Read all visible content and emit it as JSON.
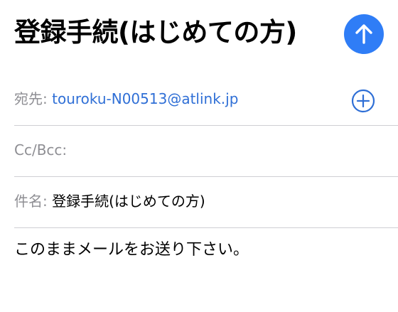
{
  "header": {
    "title": "登録手続(はじめての方)",
    "send_icon": "arrow-up-icon",
    "accent_color": "#2f7df6"
  },
  "fields": {
    "to_label": "宛先:",
    "to_value": "touroku-N00513@atlink.jp",
    "add_icon": "plus-circle-icon",
    "cc_label": "Cc/Bcc:",
    "subject_label": "件名:",
    "subject_value": "登録手続(はじめての方)"
  },
  "message": {
    "body": "このままメールをお送り下さい。"
  }
}
